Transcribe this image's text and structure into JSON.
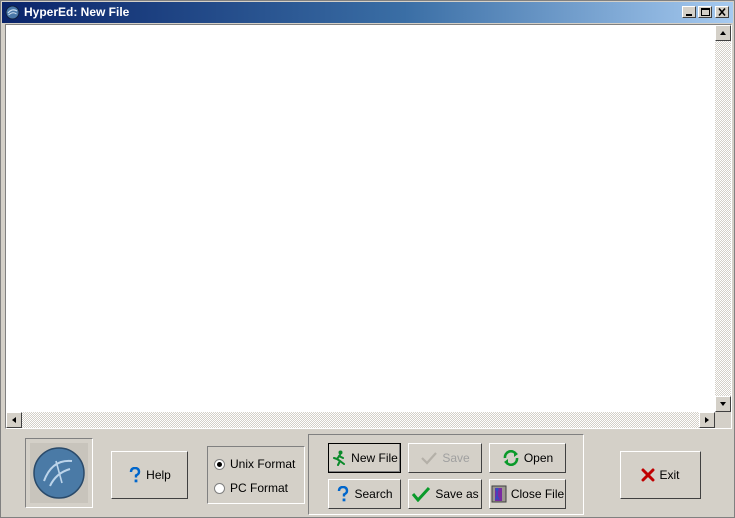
{
  "window": {
    "title": "HyperEd: New File",
    "icon": "app-globe-icon",
    "controls": [
      "minimize-icon",
      "maximize-icon",
      "close-icon"
    ]
  },
  "editor": {
    "content": "",
    "vscroll_up_icon": "arrow-up-icon",
    "vscroll_down_icon": "arrow-down-icon",
    "hscroll_left_icon": "arrow-left-icon",
    "hscroll_right_icon": "arrow-right-icon"
  },
  "toolbar": {
    "logo_icon": "hypered-logo-icon",
    "help": {
      "label": "Help",
      "icon": "question-icon"
    },
    "format": {
      "options": [
        {
          "label": "Unix Format",
          "selected": true
        },
        {
          "label": "PC Format",
          "selected": false
        }
      ]
    },
    "file_buttons": {
      "new_file": {
        "label": "New File",
        "icon": "running-man-icon",
        "enabled": true
      },
      "save": {
        "label": "Save",
        "icon": "check-icon",
        "enabled": false
      },
      "open": {
        "label": "Open",
        "icon": "refresh-icon",
        "enabled": true
      },
      "search": {
        "label": "Search",
        "icon": "question-icon",
        "enabled": true
      },
      "save_as": {
        "label": "Save as",
        "icon": "check-icon",
        "enabled": true
      },
      "close_file": {
        "label": "Close File",
        "icon": "door-icon",
        "enabled": true
      }
    },
    "exit": {
      "label": "Exit",
      "icon": "x-icon"
    }
  },
  "colors": {
    "title_gradient_start": "#0a246a",
    "title_gradient_end": "#a6caf0",
    "face": "#d4d0c8",
    "check_green": "#0a9a2a",
    "exit_red": "#c00000",
    "question_blue": "#0066cc"
  }
}
